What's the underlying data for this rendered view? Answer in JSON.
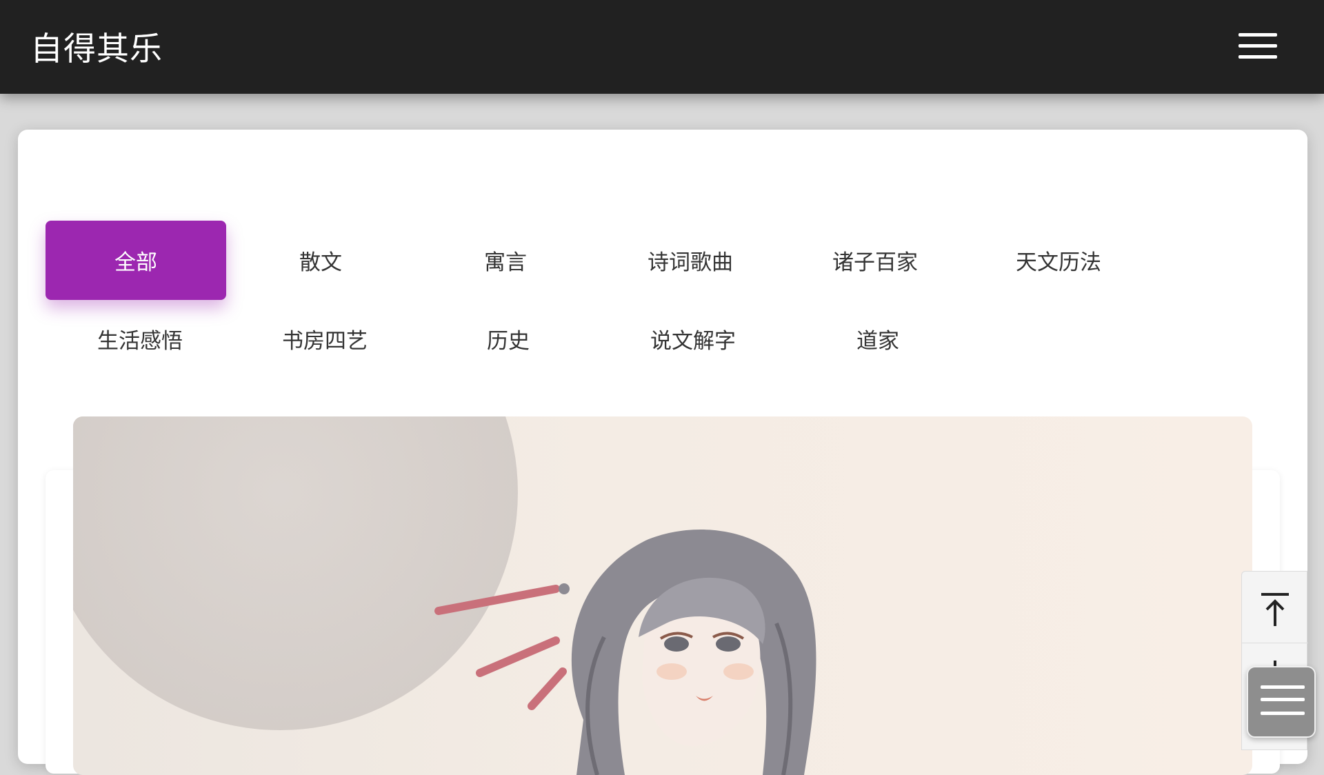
{
  "header": {
    "title": "自得其乐",
    "menu_icon": "hamburger-menu-icon"
  },
  "categories": {
    "active_index": 0,
    "row1": [
      "全部",
      "散文",
      "寓言",
      "诗词歌曲",
      "诸子百家",
      "天文历法"
    ],
    "row2": [
      "生活感悟",
      "书房四艺",
      "历史",
      "说文解字",
      "道家"
    ]
  },
  "colors": {
    "header_bg": "#212121",
    "active_tab": "#9c27b0",
    "page_bg": "#d9d9d9"
  },
  "floating_controls": {
    "scroll_top_icon": "arrow-up-to-line-icon",
    "scroll_down_icon": "arrow-down-to-line-icon",
    "list_icon": "list-icon"
  }
}
